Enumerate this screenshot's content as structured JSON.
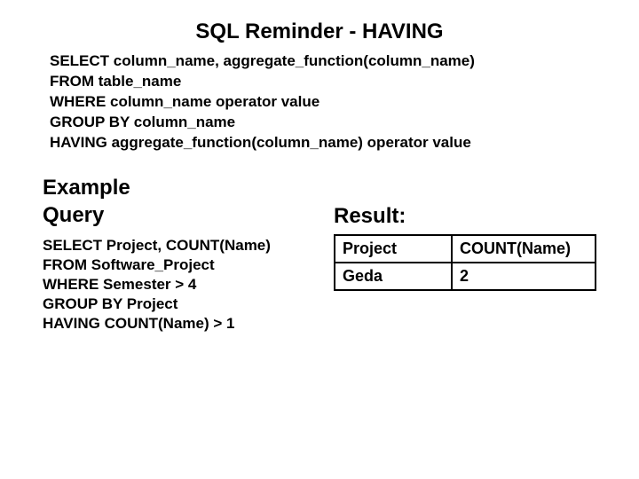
{
  "title": "SQL Reminder - HAVING",
  "syntax": {
    "line1": "SELECT column_name, aggregate_function(column_name)",
    "line2": "FROM table_name",
    "line3": "WHERE column_name operator value",
    "line4": "GROUP BY column_name",
    "line5": "HAVING aggregate_function(column_name) operator value"
  },
  "example": {
    "heading_line1": "Example",
    "heading_line2": "Query",
    "query": {
      "line1": "SELECT Project, COUNT(Name)",
      "line2": "FROM Software_Project",
      "line3": "WHERE Semester > 4",
      "line4": "GROUP BY Project",
      "line5": "HAVING COUNT(Name) > 1"
    }
  },
  "result": {
    "heading": "Result:",
    "columns": [
      "Project",
      "COUNT(Name)"
    ],
    "rows": [
      {
        "c0": "Geda",
        "c1": "2"
      }
    ]
  },
  "chart_data": {
    "type": "table",
    "title": "Result:",
    "columns": [
      "Project",
      "COUNT(Name)"
    ],
    "rows": [
      [
        "Geda",
        2
      ]
    ]
  }
}
